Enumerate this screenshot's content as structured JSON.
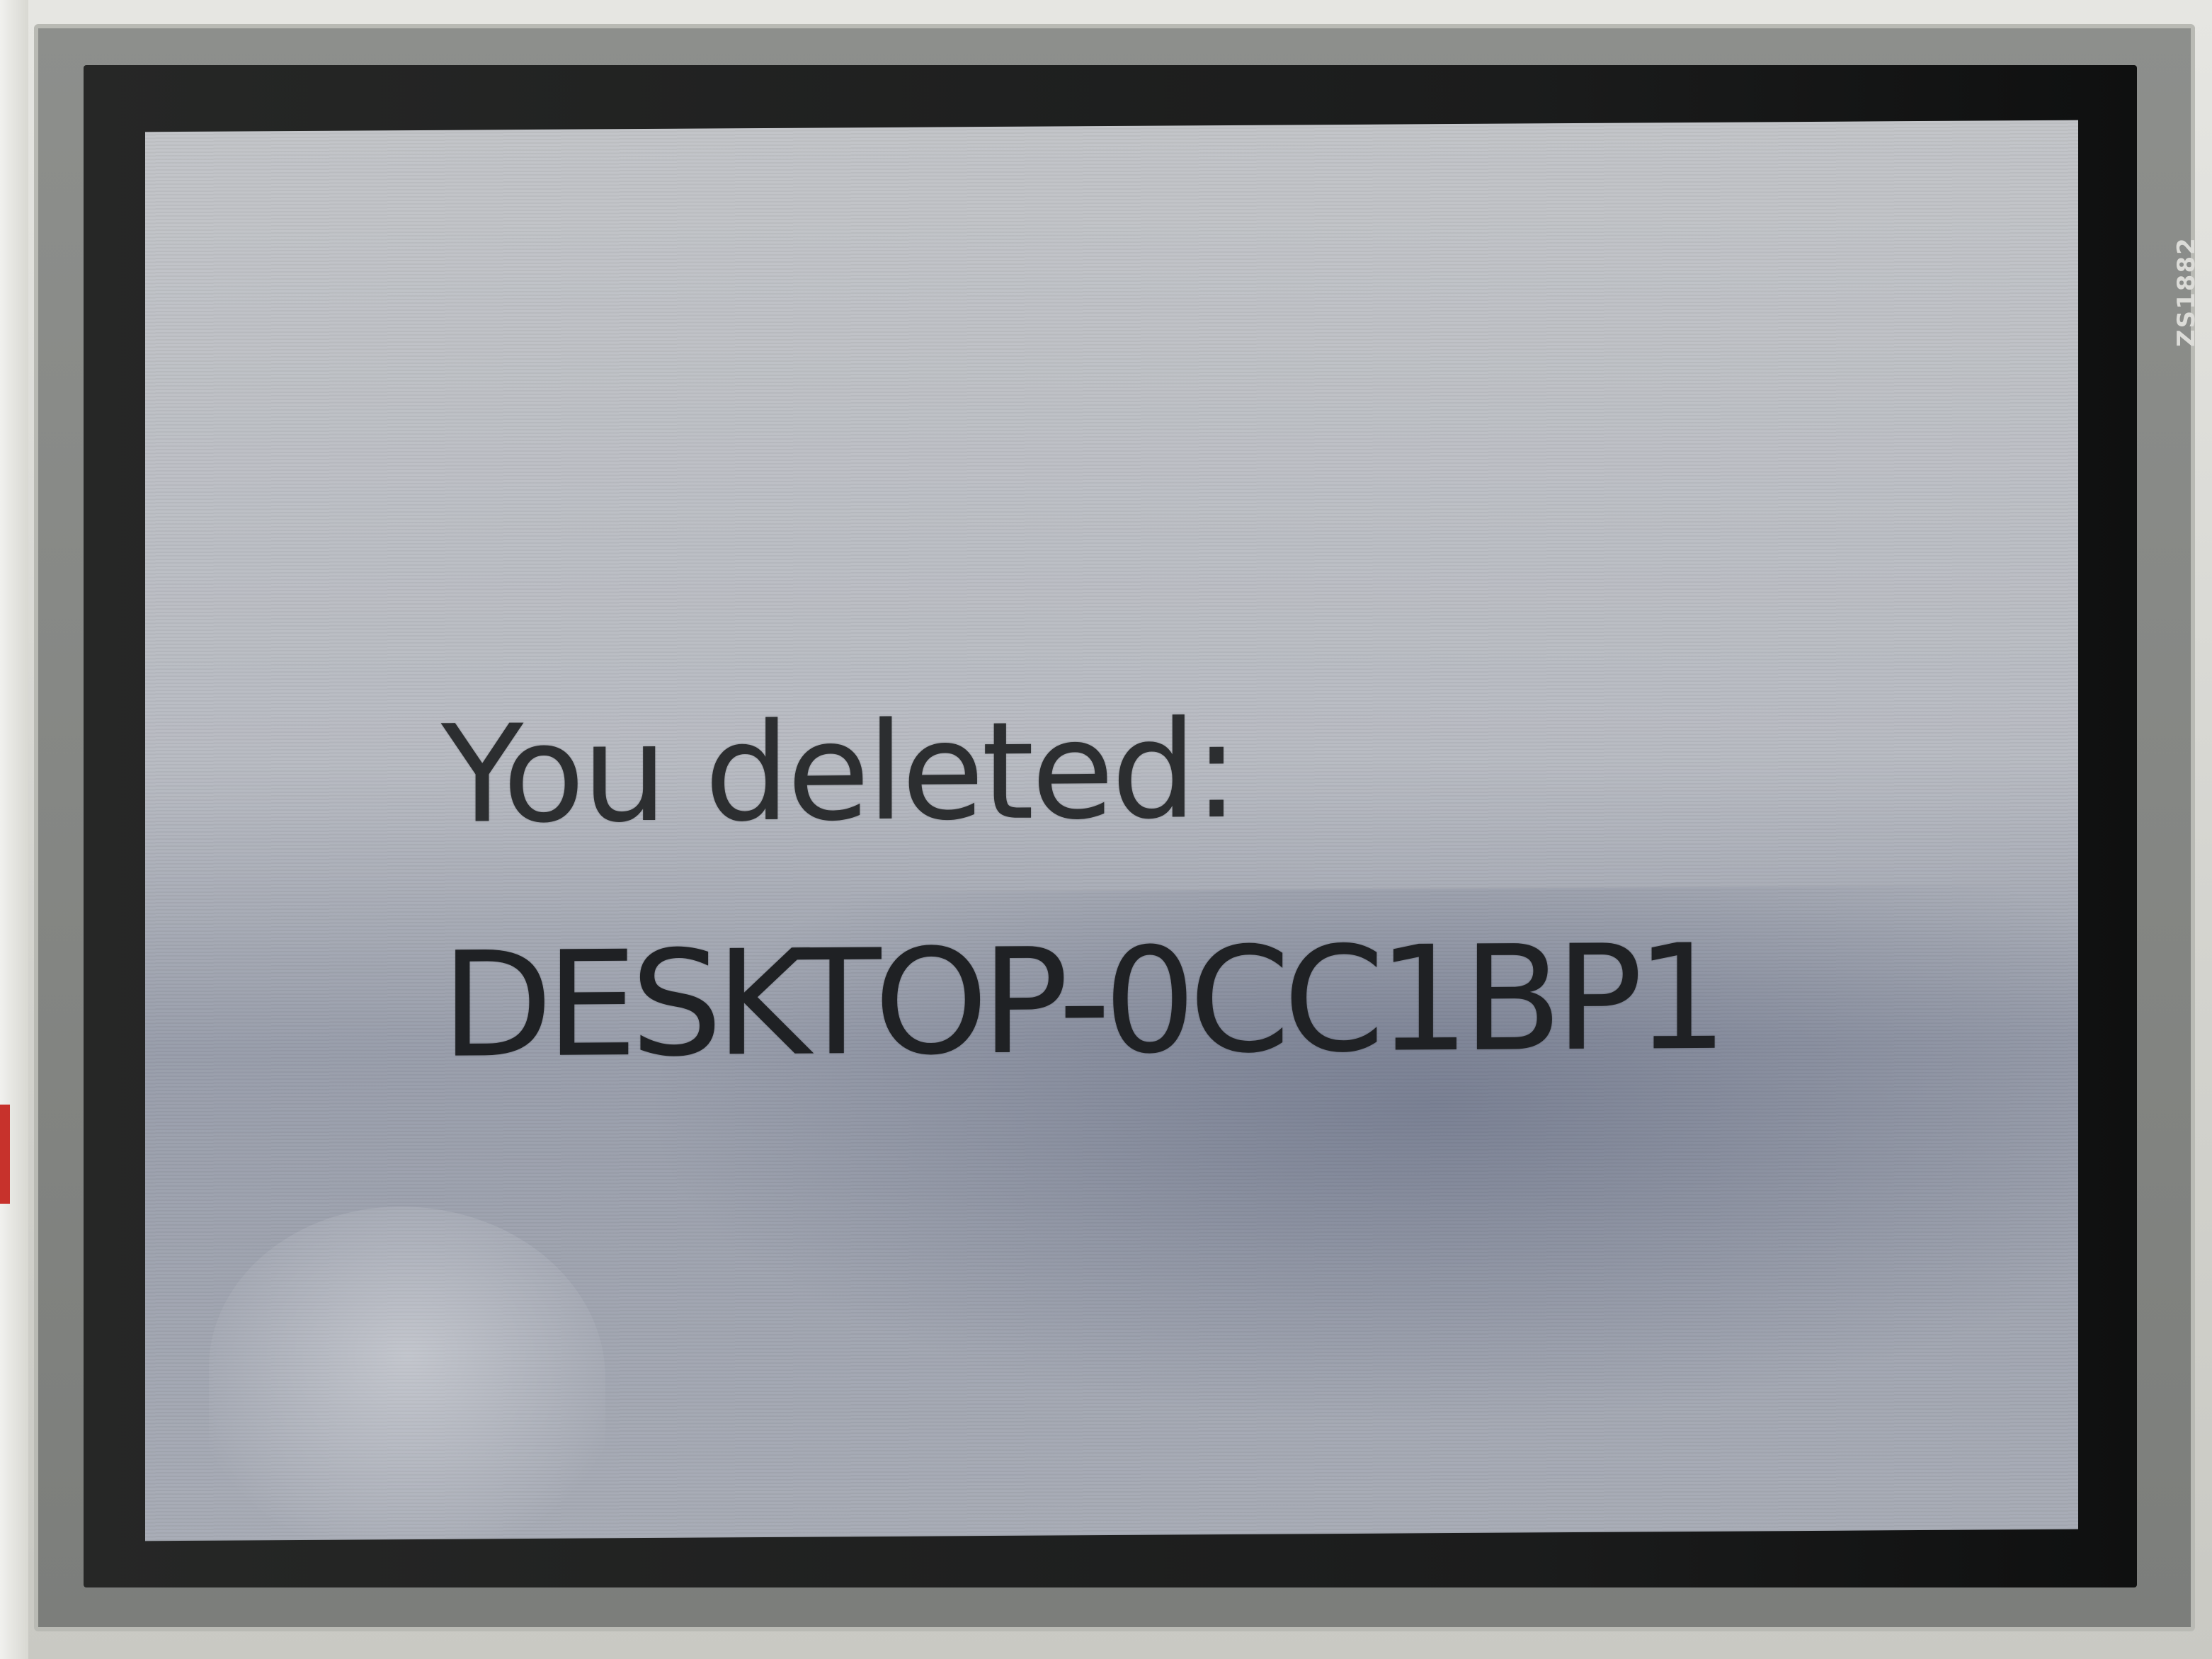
{
  "screen": {
    "message_line_1": "You deleted:",
    "message_line_2": "DESKTOP-0CC1BP1"
  },
  "bezel": {
    "printed_label": "ZS1882"
  },
  "colors": {
    "lcd_background": "#bfc1c6",
    "lcd_text": "#202225",
    "bezel_dark": "#1b1c1c",
    "casing": "#d9d9d4"
  }
}
